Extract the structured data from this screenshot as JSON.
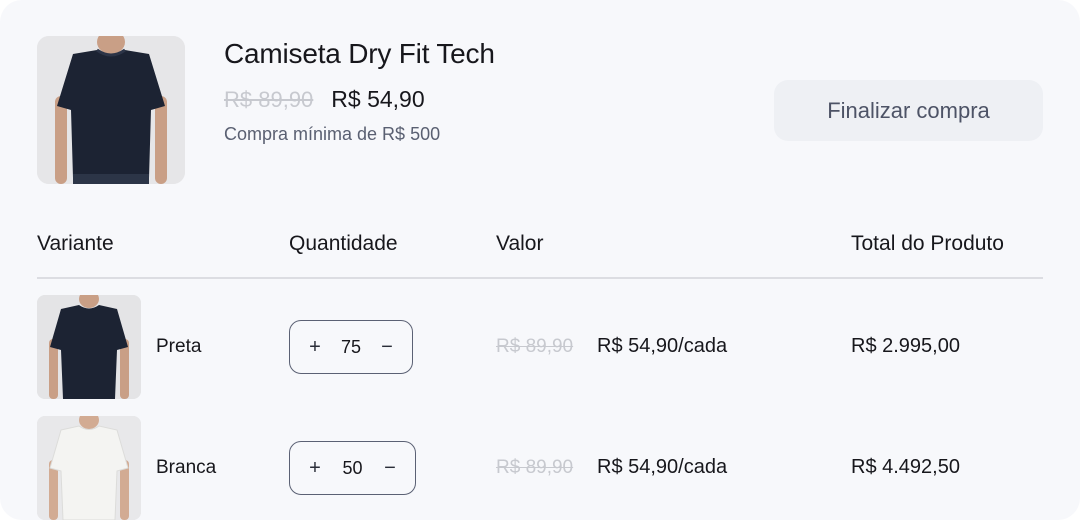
{
  "product": {
    "title": "Camiseta Dry Fit Tech",
    "old_price": "R$ 89,90",
    "new_price": "R$ 54,90",
    "min_order": "Compra mínima de R$ 500",
    "image_icon": "tshirt-photo-icon"
  },
  "checkout_button": {
    "label": "Finalizar compra"
  },
  "table": {
    "headers": {
      "variant": "Variante",
      "quantity": "Quantidade",
      "value": "Valor",
      "total": "Total do Produto"
    },
    "rows": [
      {
        "variant": "Preta",
        "shirt_color": "#1c2333",
        "quantity": "75",
        "plus": "+",
        "minus": "−",
        "old_price": "R$ 89,90",
        "unit_price": "R$ 54,90/cada",
        "total": "R$ 2.995,00"
      },
      {
        "variant": "Branca",
        "shirt_color": "#f2f2f0",
        "quantity": "50",
        "plus": "+",
        "minus": "−",
        "old_price": "R$ 89,90",
        "unit_price": "R$ 54,90/cada",
        "total": "R$ 4.492,50"
      }
    ]
  },
  "colors": {
    "background": "#f7f8fb",
    "text": "#17171c",
    "muted": "#5a6072",
    "strike": "#c7c9cf",
    "button_bg": "#eef0f4"
  }
}
